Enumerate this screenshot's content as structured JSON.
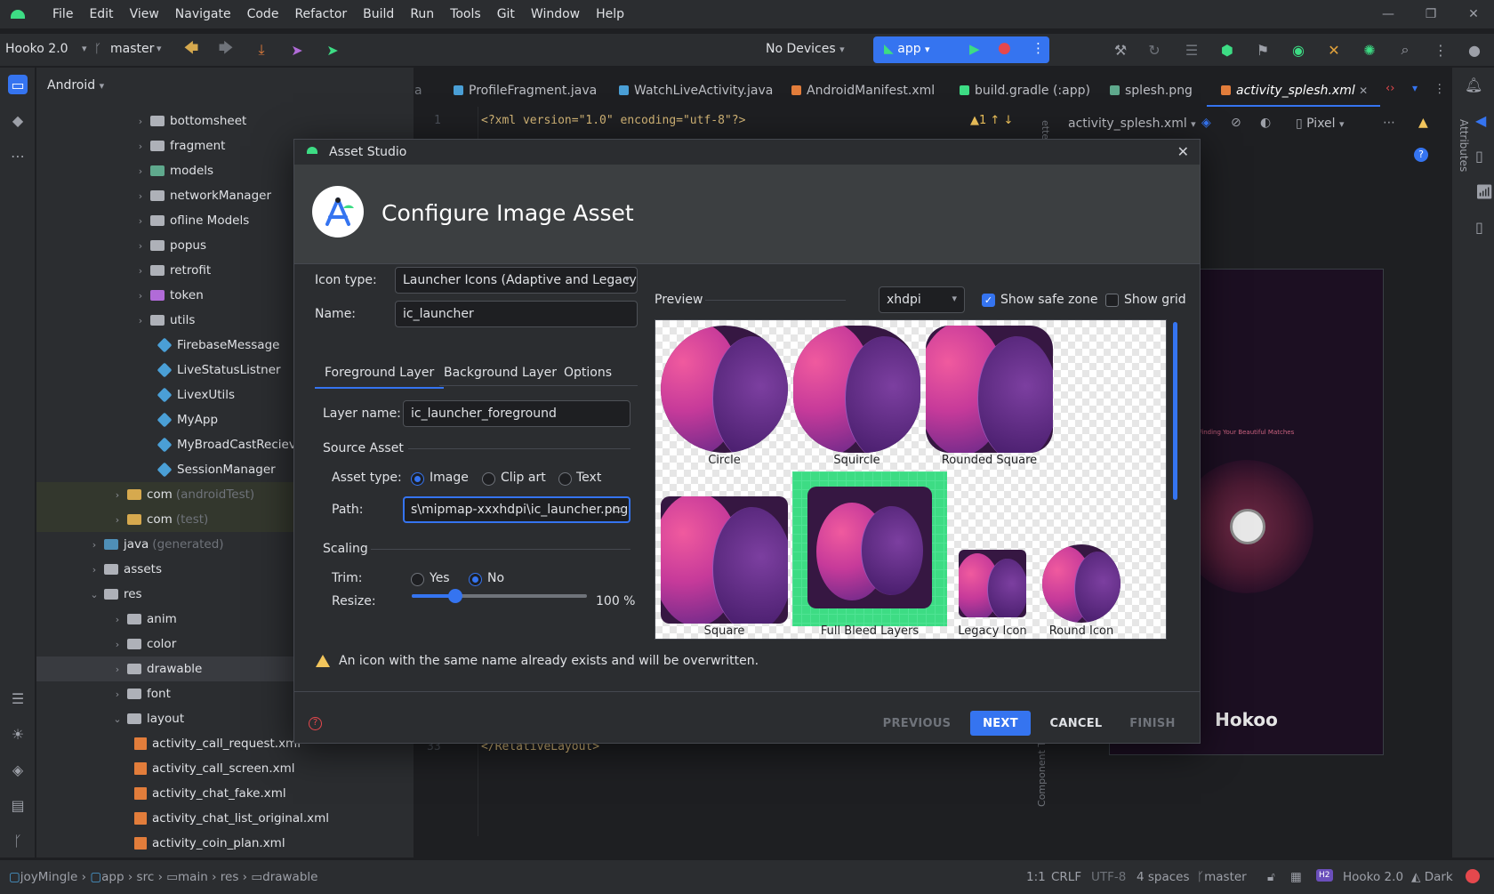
{
  "menu": [
    "File",
    "Edit",
    "View",
    "Navigate",
    "Code",
    "Refactor",
    "Build",
    "Run",
    "Tools",
    "Git",
    "Window",
    "Help"
  ],
  "toolbar": {
    "project": "Hooko 2.0",
    "branch": "master",
    "device": "No Devices",
    "run_config": "app"
  },
  "project_panel": {
    "view": "Android",
    "rows": [
      {
        "label": "bottomsheet",
        "kind": "folder",
        "indent": 3
      },
      {
        "label": "fragment",
        "kind": "folder",
        "indent": 3
      },
      {
        "label": "models",
        "kind": "folder-g",
        "indent": 3
      },
      {
        "label": "networkManager",
        "kind": "folder",
        "indent": 3
      },
      {
        "label": "ofline Models",
        "kind": "folder",
        "indent": 3
      },
      {
        "label": "popus",
        "kind": "folder",
        "indent": 3
      },
      {
        "label": "retrofit",
        "kind": "folder",
        "indent": 3
      },
      {
        "label": "token",
        "kind": "folder-p",
        "indent": 3
      },
      {
        "label": "utils",
        "kind": "folder",
        "indent": 3
      },
      {
        "label": "FirebaseMessage",
        "kind": "class",
        "indent": 4
      },
      {
        "label": "LiveStatusListner",
        "kind": "class",
        "indent": 4
      },
      {
        "label": "LivexUtils",
        "kind": "class",
        "indent": 4
      },
      {
        "label": "MyApp",
        "kind": "class",
        "indent": 4
      },
      {
        "label": "MyBroadCastReciever",
        "kind": "class",
        "indent": 4
      },
      {
        "label": "SessionManager",
        "kind": "class",
        "indent": 4
      },
      {
        "label": "com",
        "kind": "folder-y",
        "indent": 2,
        "suffix": "(androidTest)",
        "hl": true
      },
      {
        "label": "com",
        "kind": "folder-y",
        "indent": 2,
        "suffix": "(test)",
        "hl": true
      },
      {
        "label": "java",
        "kind": "folder-t",
        "indent": 1,
        "suffix": "(generated)"
      },
      {
        "label": "assets",
        "kind": "folder",
        "indent": 1
      },
      {
        "label": "res",
        "kind": "folder",
        "indent": 1,
        "open": true
      },
      {
        "label": "anim",
        "kind": "folder",
        "indent": 2
      },
      {
        "label": "color",
        "kind": "folder",
        "indent": 2
      },
      {
        "label": "drawable",
        "kind": "folder",
        "indent": 2,
        "sel": true
      },
      {
        "label": "font",
        "kind": "folder",
        "indent": 2
      },
      {
        "label": "layout",
        "kind": "folder",
        "indent": 2,
        "open": true
      },
      {
        "label": "activity_call_request.xml",
        "kind": "xml",
        "indent": 3
      },
      {
        "label": "activity_call_screen.xml",
        "kind": "xml",
        "indent": 3
      },
      {
        "label": "activity_chat_fake.xml",
        "kind": "xml",
        "indent": 3
      },
      {
        "label": "activity_chat_list_original.xml",
        "kind": "xml",
        "indent": 3
      },
      {
        "label": "activity_coin_plan.xml",
        "kind": "xml",
        "indent": 3
      }
    ]
  },
  "editor": {
    "tabs": [
      "a",
      "ProfileFragment.java",
      "WatchLiveActivity.java",
      "AndroidManifest.xml",
      "build.gradle (:app)",
      "splesh.png",
      "activity_splesh.xml"
    ],
    "line1_num": "1",
    "line1_code": "<?xml version=\"1.0\" encoding=\"utf-8\"?>",
    "last_num": "33",
    "last_code": "</RelativeLayout>",
    "warn_count": "1",
    "design_file": "activity_splesh.xml",
    "device_preview": "Pixel",
    "phone_tagline": "Finding Your Beautiful Matches",
    "phone_brand": "Hokoo",
    "side_label_attributes": "Attributes",
    "side_label_component": "Component Tr"
  },
  "dialog": {
    "window_title": "Asset Studio",
    "heading": "Configure Image Asset",
    "icon_type_label": "Icon type:",
    "icon_type_value": "Launcher Icons (Adaptive and Legacy)",
    "name_label": "Name:",
    "name_value": "ic_launcher",
    "tabs": [
      "Foreground Layer",
      "Background Layer",
      "Options"
    ],
    "layer_name_label": "Layer name:",
    "layer_name_value": "ic_launcher_foreground",
    "source_asset": "Source Asset",
    "asset_type_label": "Asset type:",
    "asset_types": [
      "Image",
      "Clip art",
      "Text"
    ],
    "path_label": "Path:",
    "path_value": "s\\mipmap-xxxhdpi\\ic_launcher.png",
    "scaling": "Scaling",
    "trim_label": "Trim:",
    "trim_yes": "Yes",
    "trim_no": "No",
    "resize_label": "Resize:",
    "resize_value": 100,
    "resize_text": "100 %",
    "preview_label": "Preview",
    "density": "xhdpi",
    "show_safe_zone": "Show safe zone",
    "show_grid": "Show grid",
    "previews": [
      "Circle",
      "Squircle",
      "Rounded Square",
      "Square",
      "Full Bleed Layers",
      "Legacy Icon",
      "Round Icon"
    ],
    "warning": "An icon with the same name already exists and will be overwritten.",
    "buttons": {
      "previous": "PREVIOUS",
      "next": "NEXT",
      "cancel": "CANCEL",
      "finish": "FINISH"
    }
  },
  "statusbar": {
    "crumbs": [
      "joyMingle",
      "app",
      "src",
      "main",
      "res",
      "drawable"
    ],
    "position": "1:1",
    "line_sep": "CRLF",
    "encoding": "UTF-8",
    "indent": "4 spaces",
    "branch": "master",
    "project": "Hooko 2.0",
    "project_badge": "H2",
    "theme": "Dark"
  }
}
